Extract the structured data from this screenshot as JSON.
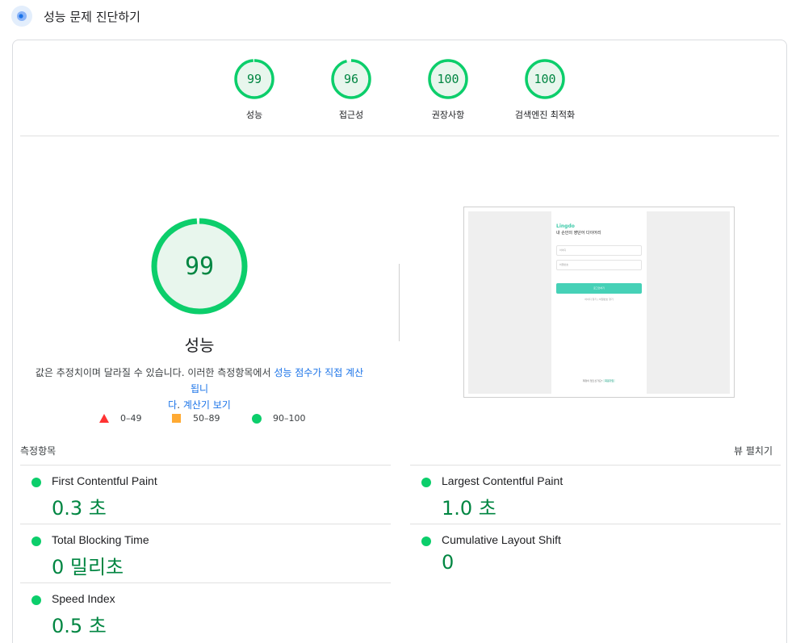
{
  "header": {
    "title": "성능 문제 진단하기",
    "icon": "lighthouse-logo-icon"
  },
  "gauges": [
    {
      "score": "99",
      "label": "성능",
      "fraction": 0.99
    },
    {
      "score": "96",
      "label": "접근성",
      "fraction": 0.96
    },
    {
      "score": "100",
      "label": "권장사항",
      "fraction": 1.0
    },
    {
      "score": "100",
      "label": "검색엔진 최적화",
      "fraction": 1.0
    }
  ],
  "performance": {
    "score": "99",
    "fraction": 0.99,
    "title": "성능",
    "description_part1": "값은 추정치이며 달라질 수 있습니다. 이러한 측정항목에서 ",
    "description_link1": "성능 점수가 직접 계산됩니",
    "description_link1b": "다",
    "description_part2": ". ",
    "description_link2": "계산기 보기"
  },
  "legend": [
    {
      "range": "0–49",
      "shape": "triangle",
      "color": "#ff3333"
    },
    {
      "range": "50–89",
      "shape": "square",
      "color": "#ffaa33"
    },
    {
      "range": "90–100",
      "shape": "circle",
      "color": "#0cce6b"
    }
  ],
  "screenshot": {
    "brand": "Lingdo",
    "heading": "내 손안의 영단어 다이어리",
    "field1_placeholder": "아이디",
    "field2_placeholder": "비밀번호",
    "login_label": "로그인하기",
    "links": "아이디 찾기 | 비밀번호 찾기",
    "footer_text": "계정이 없으신가요?",
    "signup_label": "회원가입"
  },
  "metrics_section": {
    "label": "측정항목",
    "expand_label": "뷰 펼치기"
  },
  "metrics": [
    {
      "name": "First Contentful Paint",
      "value": "0.3 초"
    },
    {
      "name": "Largest Contentful Paint",
      "value": "1.0 초"
    },
    {
      "name": "Total Blocking Time",
      "value": "0 밀리초"
    },
    {
      "name": "Cumulative Layout Shift",
      "value": "0"
    },
    {
      "name": "Speed Index",
      "value": "0.5 초"
    }
  ],
  "colors": {
    "pass": "#0cce6b",
    "pass_text": "#018642",
    "pass_fill": "#e8f6ed",
    "link": "#1a73e8"
  }
}
